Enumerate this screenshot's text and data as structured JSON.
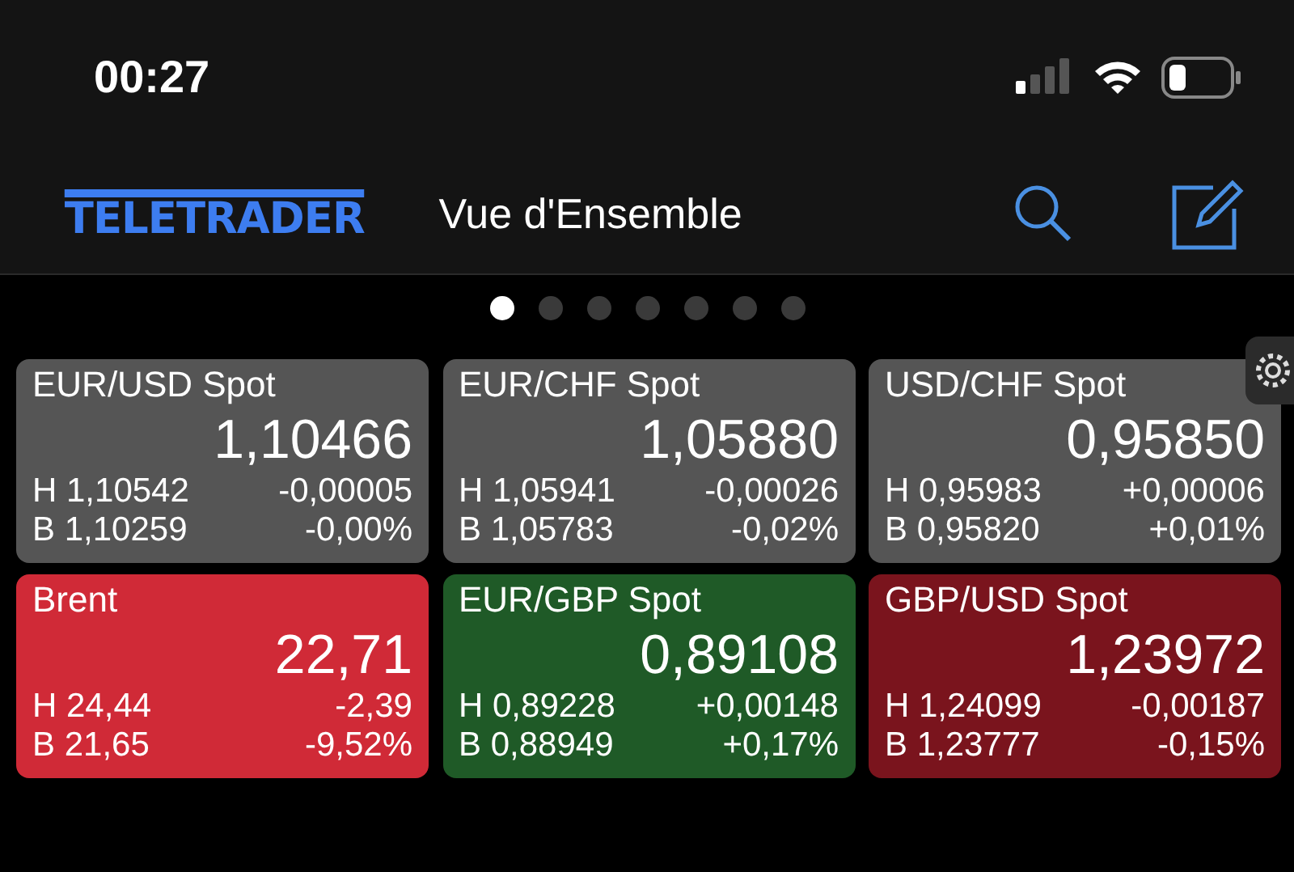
{
  "status_bar": {
    "time": "00:27"
  },
  "header": {
    "logo": "TELETRADER",
    "title": "Vue d'Ensemble"
  },
  "pages": [
    {
      "selected": true
    },
    {
      "selected": false
    },
    {
      "selected": false
    },
    {
      "selected": false
    },
    {
      "selected": false
    },
    {
      "selected": false
    },
    {
      "selected": false
    }
  ],
  "tiles": [
    {
      "name": "EUR/USD Spot",
      "price": "1,10466",
      "high": "H 1,10542",
      "change": "-0,00005",
      "low": "B 1,10259",
      "change_pct": "-0,00%",
      "color": "#555555"
    },
    {
      "name": "EUR/CHF Spot",
      "price": "1,05880",
      "high": "H 1,05941",
      "change": "-0,00026",
      "low": "B 1,05783",
      "change_pct": "-0,02%",
      "color": "#555555"
    },
    {
      "name": "USD/CHF Spot",
      "price": "0,95850",
      "high": "H 0,95983",
      "change": "+0,00006",
      "low": "B 0,95820",
      "change_pct": "+0,01%",
      "color": "#555555"
    },
    {
      "name": "Brent",
      "price": "22,71",
      "high": "H 24,44",
      "change": "-2,39",
      "low": "B 21,65",
      "change_pct": "-9,52%",
      "color": "#d02a37"
    },
    {
      "name": "EUR/GBP Spot",
      "price": "0,89108",
      "high": "H 0,89228",
      "change": "+0,00148",
      "low": "B 0,88949",
      "change_pct": "+0,17%",
      "color": "#1f5a27"
    },
    {
      "name": "GBP/USD Spot",
      "price": "1,23972",
      "high": "H 1,24099",
      "change": "-0,00187",
      "low": "B 1,23777",
      "change_pct": "-0,15%",
      "color": "#7a141d"
    }
  ]
}
